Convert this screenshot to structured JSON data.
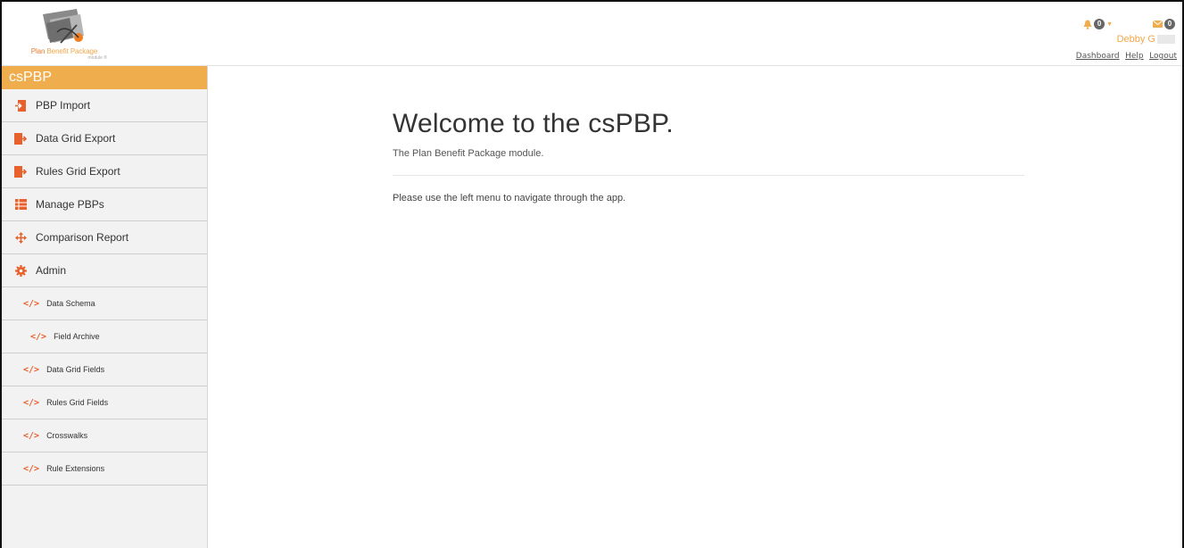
{
  "header": {
    "logo": {
      "brand_prefix": "Plan",
      "brand_name": "Benefit Package",
      "sub": "module ®"
    },
    "notifications": {
      "count": "0"
    },
    "messages": {
      "count": "0"
    },
    "user": {
      "name": "Debby G"
    },
    "links": {
      "dashboard": "Dashboard",
      "help": "Help",
      "logout": "Logout"
    }
  },
  "sidebar": {
    "title": "csPBP",
    "items": [
      {
        "label": "PBP Import",
        "icon": "import-icon"
      },
      {
        "label": "Data Grid Export",
        "icon": "export-icon"
      },
      {
        "label": "Rules Grid Export",
        "icon": "export-icon"
      },
      {
        "label": "Manage PBPs",
        "icon": "table-icon"
      },
      {
        "label": "Comparison Report",
        "icon": "arrows-icon"
      },
      {
        "label": "Admin",
        "icon": "gear-icon"
      }
    ],
    "sub_items": [
      {
        "label": "Data Schema"
      },
      {
        "label": "Field Archive"
      },
      {
        "label": "Data Grid Fields"
      },
      {
        "label": "Rules Grid Fields"
      },
      {
        "label": "Crosswalks"
      },
      {
        "label": "Rule Extensions"
      }
    ],
    "code_glyph": "</>"
  },
  "main": {
    "title": "Welcome to the csPBP.",
    "subtitle": "The Plan Benefit Package module.",
    "instructions": "Please use the left menu to navigate through the app."
  },
  "colors": {
    "accent": "#f0ad4e",
    "icon": "#e8612c"
  }
}
